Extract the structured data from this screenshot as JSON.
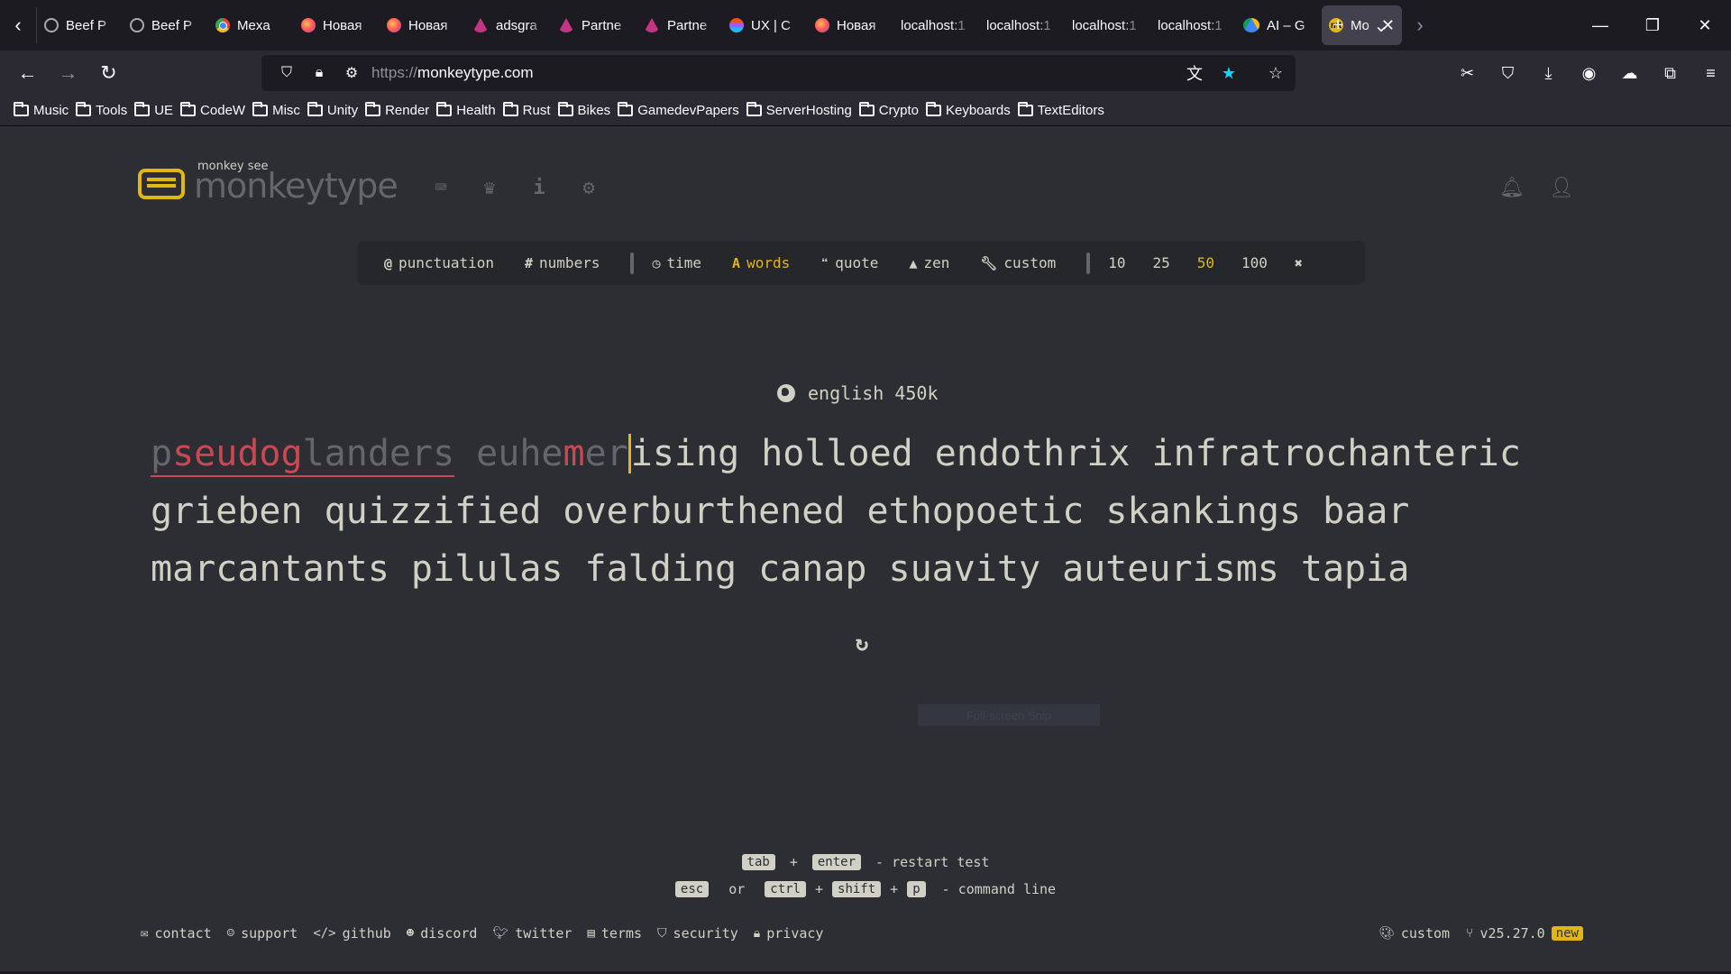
{
  "browser": {
    "tabs": [
      {
        "label": "Beef P",
        "icon": "globe-icon"
      },
      {
        "label": "Beef P",
        "icon": "globe-icon"
      },
      {
        "label": "Mexa",
        "icon": "chrome-icon"
      },
      {
        "label": "Новая",
        "icon": "firefox-icon"
      },
      {
        "label": "Новая",
        "icon": "firefox-icon"
      },
      {
        "label": "adsgra",
        "icon": "affinity-icon"
      },
      {
        "label": "Partne",
        "icon": "affinity-icon"
      },
      {
        "label": "Partne",
        "icon": "affinity-icon"
      },
      {
        "label": "UX | C",
        "icon": "figma-icon"
      },
      {
        "label": "Новая",
        "icon": "firefox-icon"
      },
      {
        "label": "localhost:1",
        "icon": "none"
      },
      {
        "label": "localhost:1",
        "icon": "none"
      },
      {
        "label": "localhost:1",
        "icon": "none"
      },
      {
        "label": "localhost:1",
        "icon": "none"
      },
      {
        "label": "AI – G",
        "icon": "drive-icon"
      },
      {
        "label": "Mo",
        "icon": "monkeytype-icon",
        "active": true
      }
    ],
    "url_scheme": "https://",
    "url_host": "monkeytype.com",
    "bookmarks": [
      "Music",
      "Tools",
      "UE",
      "CodeW",
      "Misc",
      "Unity",
      "Render",
      "Health",
      "Rust",
      "Bikes",
      "GamedevPapers",
      "ServerHosting",
      "Crypto",
      "Keyboards",
      "TextEditors"
    ]
  },
  "app": {
    "logo_text": "monkeytype",
    "logo_sub": "monkey see",
    "accent_color": "#e2b714",
    "error_color": "#ca4754"
  },
  "config": {
    "punctuation": "punctuation",
    "numbers": "numbers",
    "modes": [
      "time",
      "words",
      "quote",
      "zen",
      "custom"
    ],
    "active_mode": "words",
    "word_counts": [
      "10",
      "25",
      "50",
      "100"
    ],
    "active_count": "50"
  },
  "test": {
    "language": "english 450k",
    "typed_words": [
      [
        {
          "t": "p",
          "s": "typed"
        },
        {
          "t": "seudog",
          "s": "err"
        },
        {
          "t": "landers",
          "s": "typed"
        }
      ]
    ],
    "current_word": [
      {
        "t": "euhe",
        "s": "typed"
      },
      {
        "t": "m",
        "s": "err"
      },
      {
        "t": "er",
        "s": "typed"
      },
      {
        "t": "ising",
        "s": "untyped"
      }
    ],
    "lines": [
      [
        "holloed",
        "endothrix",
        "infratrochanteric"
      ],
      [
        "grieben",
        "quizzified",
        "overburthened",
        "ethopoetic",
        "skankings",
        "baar"
      ],
      [
        "marcantants",
        "pilulas",
        "falding",
        "canap",
        "suavity",
        "auteurisms",
        "tapia"
      ]
    ]
  },
  "overlay": {
    "snip_label": "Full-screen Snip"
  },
  "keytips": {
    "tab": "tab",
    "plus": "+",
    "enter": "enter",
    "restart_text": "- restart test",
    "esc": "esc",
    "or": "or",
    "ctrl": "ctrl",
    "shift": "shift",
    "p": "p",
    "command_text": "- command line"
  },
  "footer": {
    "links": [
      "contact",
      "support",
      "github",
      "discord",
      "twitter",
      "terms",
      "security",
      "privacy"
    ],
    "theme": "custom",
    "version": "v25.27.0",
    "new_badge": "new"
  }
}
